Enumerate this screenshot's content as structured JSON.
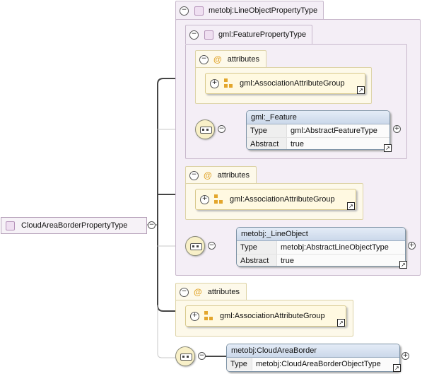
{
  "root": {
    "label": "CloudAreaBorderPropertyType"
  },
  "line_object_type": {
    "label": "metobj:LineObjectPropertyType"
  },
  "feature_property_type": {
    "label": "gml:FeaturePropertyType"
  },
  "attributes_label": "attributes",
  "association_group_label": "gml:AssociationAttributeGroup",
  "feature_element": {
    "name": "gml:_Feature",
    "rows": [
      {
        "key": "Type",
        "value": "gml:AbstractFeatureType"
      },
      {
        "key": "Abstract",
        "value": "true"
      }
    ]
  },
  "line_object_element": {
    "name": "metobj:_LineObject",
    "rows": [
      {
        "key": "Type",
        "value": "metobj:AbstractLineObjectType"
      },
      {
        "key": "Abstract",
        "value": "true"
      }
    ]
  },
  "cloud_area_border_element": {
    "name": "metobj:CloudAreaBorder",
    "rows": [
      {
        "key": "Type",
        "value": "metobj:CloudAreaBorderObjectType"
      }
    ]
  },
  "icons": {
    "collapse": "minus-circle-icon",
    "expand": "plus-circle-icon",
    "sequence": "sequence-icon",
    "attribute_group": "attribute-group-icon",
    "shortcut": "shortcut-arrow-icon"
  },
  "colors": {
    "type_container": "#f4eef6",
    "attribute_container": "#fdf9ea",
    "group_box": "#fff9e1",
    "element_header": "#cbd8ea",
    "accent_orange": "#e3a62c"
  }
}
